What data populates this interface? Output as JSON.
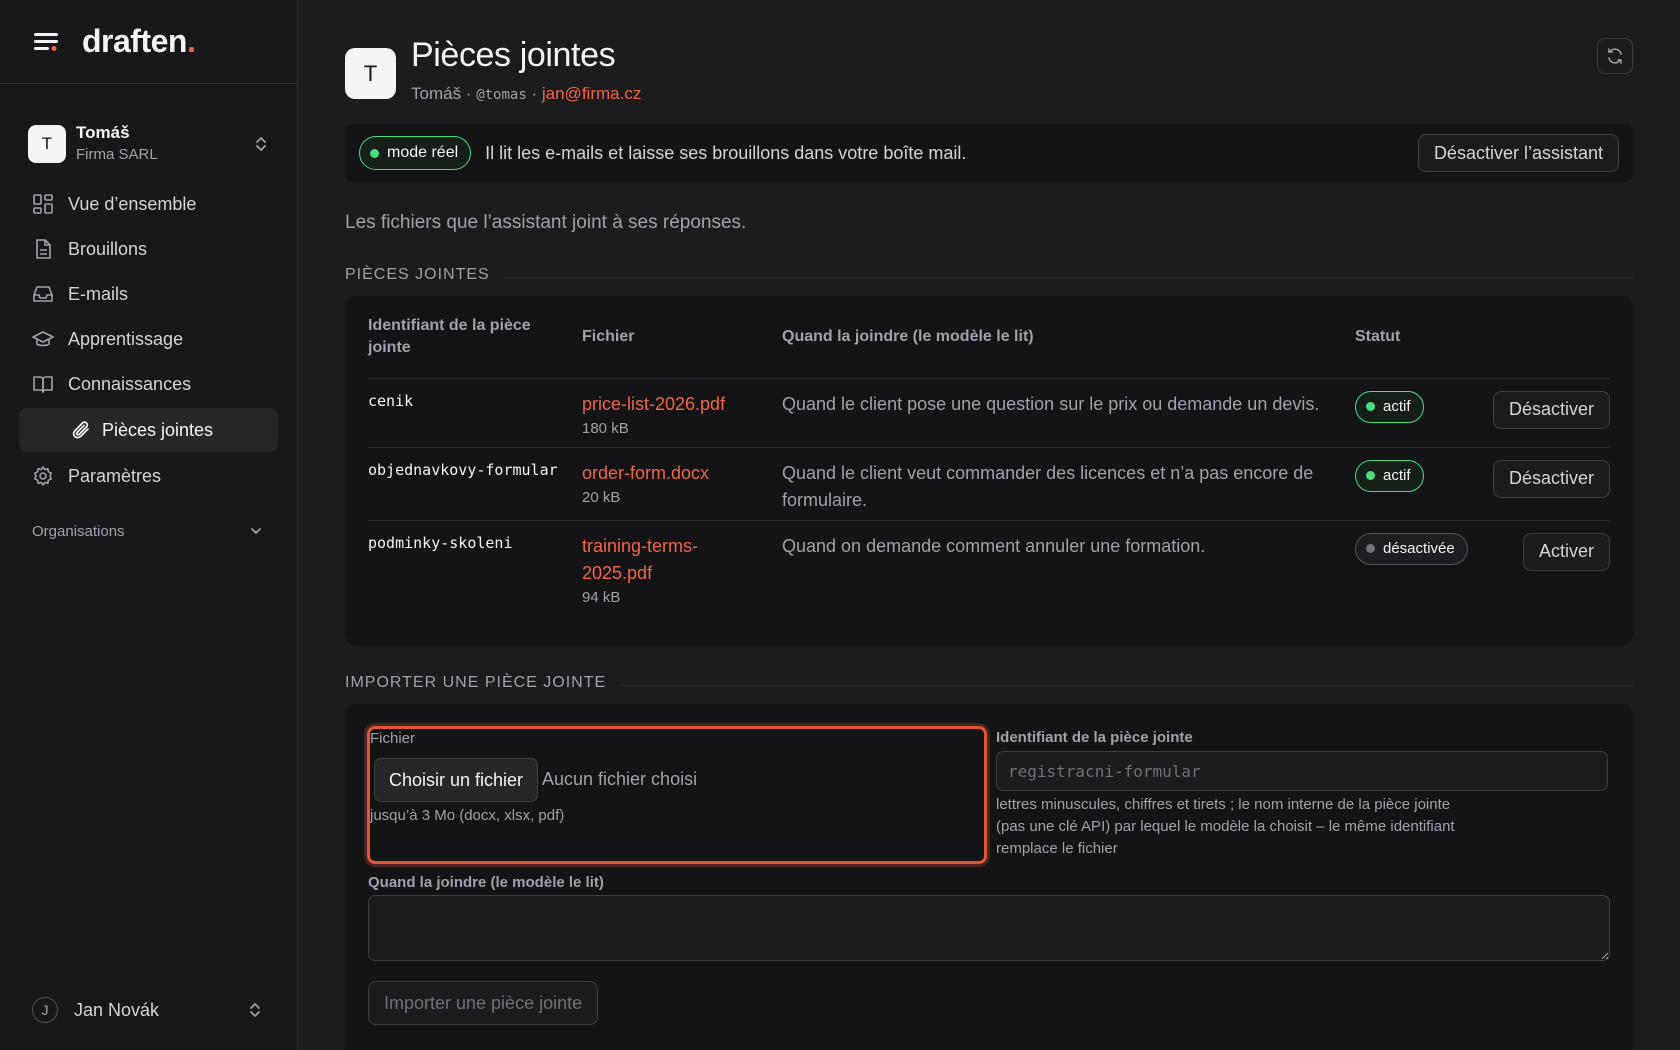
{
  "app": {
    "logo_text": "draften",
    "logo_dot": ".",
    "accent": "#f0654a"
  },
  "account": {
    "initial": "T",
    "name": "Tomáš",
    "org": "Firma SARL"
  },
  "nav": [
    {
      "label": "Vue d’ensemble",
      "icon": "grid-icon"
    },
    {
      "label": "Brouillons",
      "icon": "document-icon"
    },
    {
      "label": "E-mails",
      "icon": "inbox-icon"
    },
    {
      "label": "Apprentissage",
      "icon": "graduation-cap-icon"
    },
    {
      "label": "Connaissances",
      "icon": "book-icon"
    },
    {
      "label": "Pièces jointes",
      "icon": "paperclip-icon"
    },
    {
      "label": "Paramètres",
      "icon": "gear-icon"
    }
  ],
  "organisations": {
    "label": "Organisations"
  },
  "user": {
    "initial": "J",
    "name": "Jan Novák"
  },
  "header": {
    "initial": "T",
    "title": "Pièces jointes",
    "name": "Tomáš",
    "sep": " · ",
    "handle": "@tomas",
    "email": "jan@firma.cz"
  },
  "mode": {
    "badge": "mode réel",
    "text": "Il lit les e-mails et laisse ses brouillons dans votre boîte mail.",
    "disable_button": "Désactiver l’assistant"
  },
  "description": "Les fichiers que l’assistant joint à ses réponses.",
  "attachments": {
    "section_title": "PIÈCES JOINTES",
    "columns": [
      "Identifiant de la pièce jointe",
      "Fichier",
      "Quand la joindre (le modèle le lit)",
      "Statut"
    ],
    "rows": [
      {
        "id": "cenik",
        "file": "price-list-2026.pdf",
        "size": "180 kB",
        "when": "Quand le client pose une question sur le prix ou demande un devis.",
        "status": "actif",
        "action": "Désactiver"
      },
      {
        "id": "objednavkovy-formular",
        "file": "order-form.docx",
        "size": "20 kB",
        "when": "Quand le client veut commander des licences et n’a pas encore de formulaire.",
        "status": "actif",
        "action": "Désactiver"
      },
      {
        "id": "podminky-skoleni",
        "file": "training-terms-2025.pdf",
        "size": "94 kB",
        "when": "Quand on demande comment annuler une formation.",
        "status": "désactivée",
        "action": "Activer"
      }
    ]
  },
  "import": {
    "section_title": "IMPORTER UNE PIÈCE JOINTE",
    "file_label": "Fichier",
    "file_button": "Choisir un fichier",
    "file_none": "Aucun fichier choisi",
    "file_hint": "jusqu’à 3 Mo (docx, xlsx, pdf)",
    "id_label": "Identifiant de la pièce jointe",
    "id_placeholder": "registracni-formular",
    "id_hint_1": "lettres minuscules, chiffres et tirets ; le nom interne de la pièce jointe",
    "id_hint_2": "(pas une clé API) par lequel le modèle la choisit – le même identifiant",
    "id_hint_3": "remplace le fichier",
    "when_label": "Quand la joindre (le modèle le lit)",
    "submit": "Importer une pièce jointe"
  }
}
